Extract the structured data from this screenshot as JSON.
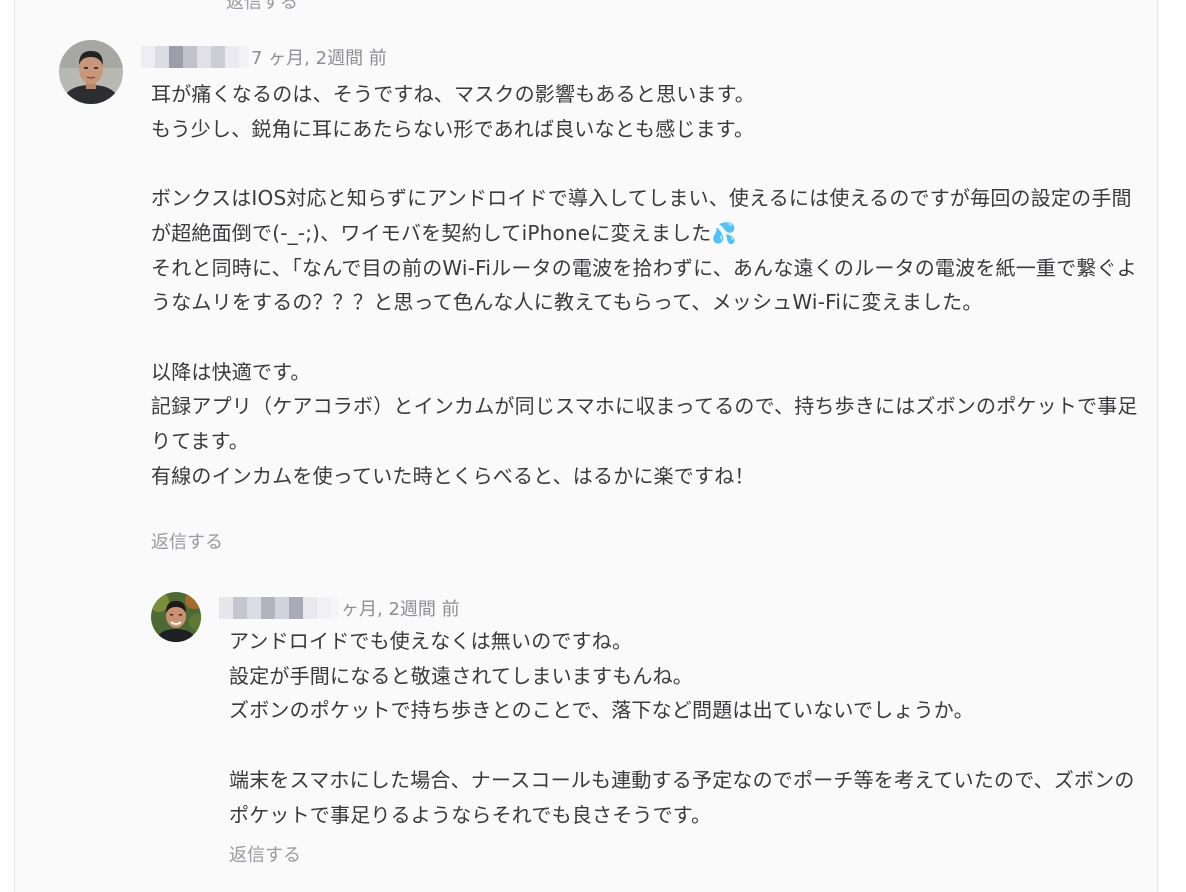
{
  "thread": {
    "previous_reply_label": "返信する"
  },
  "comments": [
    {
      "timestamp": "7 ヶ月, 2週間 前",
      "avatar": "avatar-photo",
      "body": "耳が痛くなるのは、そうですね、マスクの影響もあると思います。\nもう少し、鋭角に耳にあたらない形であれば良いなとも感じます。\n\nボンクスはIOS対応と知らずにアンドロイドで導入してしまい、使えるには使えるのですが毎回の設定の手間が超絶面倒で(-_-;)、ワイモバを契約してiPhoneに変えました💦\nそれと同時に、「なんで目の前のWi-Fiルータの電波を拾わずに、あんな遠くのルータの電波を紙一重で繋ぐようなムリをするの？？？と思って色んな人に教えてもらって、メッシュWi-Fiに変えました。\n\n以降は快適です。\n記録アプリ（ケアコラボ）とインカムが同じスマホに収まってるので、持ち歩きにはズボンのポケットで事足りてます。\n有線のインカムを使っていた時とくらべると、はるかに楽ですね！",
      "reply_label": "返信する"
    },
    {
      "timestamp": "ヶ月, 2週間 前",
      "avatar": "avatar-photo",
      "body": "アンドロイドでも使えなくは無いのですね。\n設定が手間になると敬遠されてしまいますもんね。\nズボンのポケットで持ち歩きとのことで、落下など問題は出ていないでしょうか。\n\n端末をスマホにした場合、ナースコールも連動する予定なのでポーチ等を考えていたので、ズボンのポケットで事足りるようならそれでも良さそうです。",
      "reply_label": "返信する"
    }
  ]
}
